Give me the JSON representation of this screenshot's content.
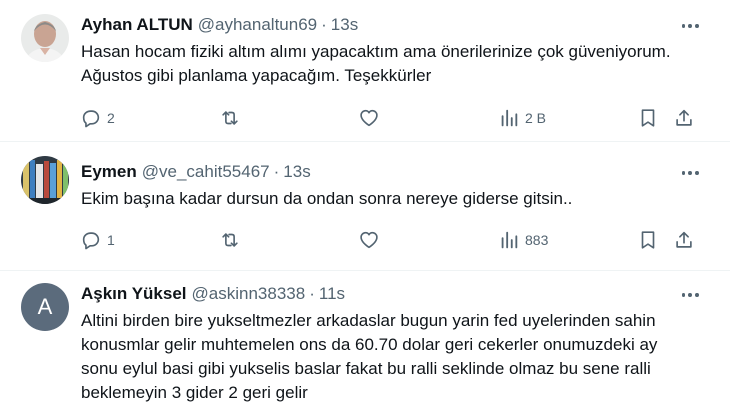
{
  "tweets": [
    {
      "name": "Ayhan ALTUN",
      "handle": "@ayhanaltun69",
      "separator": "·",
      "time": "13s",
      "text": "Hasan hocam fiziki altım alımı yapacaktım ama önerilerinize çok güveniyorum. Ağustos gibi planlama yapacağım. Teşekkürler",
      "avatar_icon": "man-portrait-icon",
      "replies": "2",
      "retweets": "",
      "likes": "",
      "views": "2 B"
    },
    {
      "name": "Eymen",
      "handle": "@ve_cahit55467",
      "separator": "·",
      "time": "13s",
      "text": "Ekim başına kadar dursun da ondan sonra nereye giderse gitsin..",
      "avatar_icon": "bookshelf-icon",
      "replies": "1",
      "retweets": "",
      "likes": "",
      "views": "883"
    },
    {
      "name": "Aşkın Yüksel",
      "handle": "@askinn38338",
      "separator": "·",
      "time": "11s",
      "text": "Altini birden bire yukseltmezler arkadaslar bugun yarin fed uyelerinden sahin konusmlar gelir muhtemelen ons da 60.70 dolar geri cekerler onumuzdeki ay sonu eylul basi gibi yukselis baslar fakat bu ralli seklinde olmaz bu sene ralli beklemeyin 3 gider 2 geri gelir",
      "avatar_letter": "A",
      "avatar_color": "#5b6b7c"
    }
  ],
  "colors": {
    "text": "#0f1419",
    "muted": "#536471",
    "divider": "#eff3f4"
  }
}
